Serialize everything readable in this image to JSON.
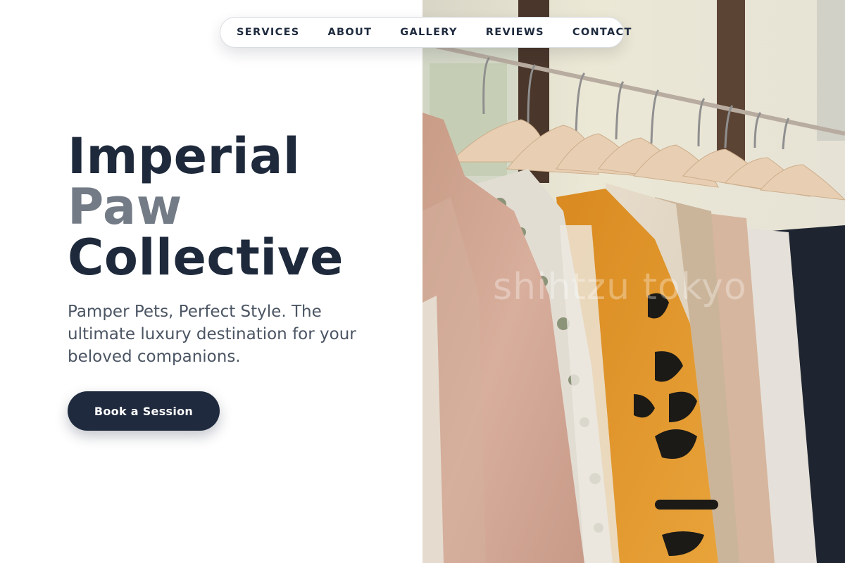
{
  "nav": {
    "items": [
      {
        "label": "SERVICES"
      },
      {
        "label": "ABOUT"
      },
      {
        "label": "GALLERY"
      },
      {
        "label": "REVIEWS"
      },
      {
        "label": "CONTACT"
      }
    ]
  },
  "hero": {
    "title_line_1": "Imperial",
    "title_line_2": "Paw",
    "title_line_3": "Collective",
    "subtitle": "Pamper Pets, Perfect Style. The ultimate luxury destination for your beloved companions.",
    "cta_label": "Book a Session",
    "image": {
      "subject": "clothes rack with pastel and floral shirts on wooden hangers",
      "watermark": "shihtzu tokyo"
    }
  },
  "colors": {
    "title": "#1e293b",
    "title_muted": "#737b86",
    "body_text": "#4b5563",
    "button_bg": "#1f2a3e",
    "button_text": "#ffffff",
    "nav_text": "#1e2a3e"
  }
}
